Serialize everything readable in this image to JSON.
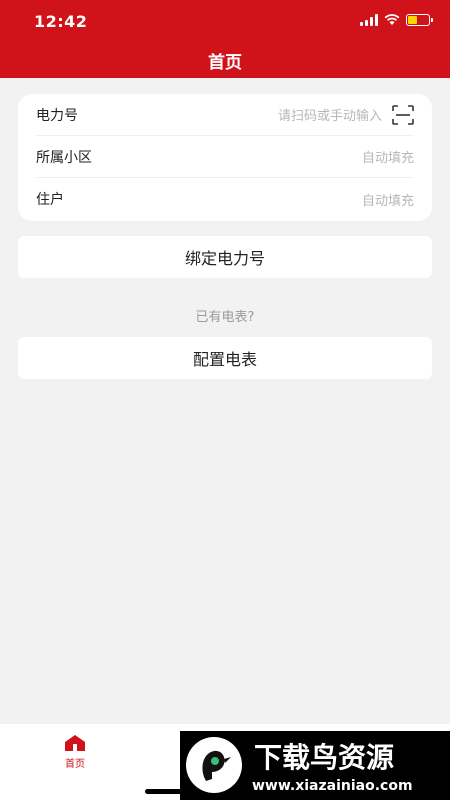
{
  "status_bar": {
    "time": "12:42"
  },
  "header": {
    "title": "首页"
  },
  "form": {
    "power_number": {
      "label": "电力号",
      "placeholder": "请扫码或手动输入"
    },
    "community": {
      "label": "所属小区",
      "placeholder": "自动填充"
    },
    "household": {
      "label": "住户",
      "placeholder": "自动填充"
    }
  },
  "actions": {
    "bind_label": "绑定电力号",
    "hint": "已有电表?",
    "config_label": "配置电表"
  },
  "tabbar": {
    "home_label": "首页"
  },
  "watermark": {
    "brand": "下载鸟资源",
    "url": "www.xiazainiao.com"
  },
  "colors": {
    "brand": "#d0131b",
    "background": "#f2f2f2"
  },
  "icons": [
    "signal-icon",
    "wifi-icon",
    "battery-icon",
    "scan-icon",
    "home-icon"
  ]
}
